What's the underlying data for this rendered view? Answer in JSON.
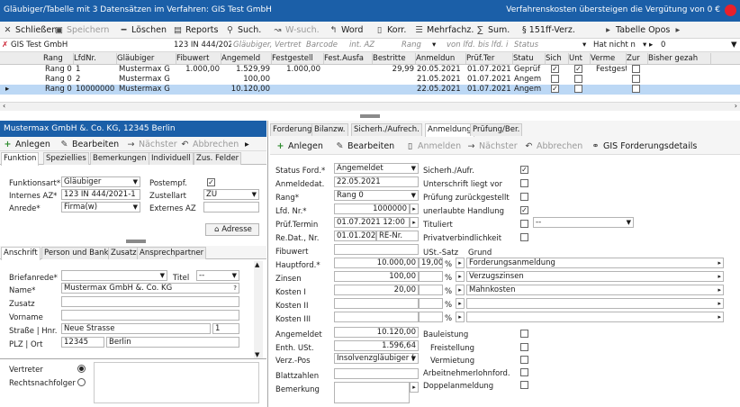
{
  "titlebar": {
    "left": "Gläubiger/Tabelle mit 3 Datensätzen im Verfahren: GIS Test GmbH",
    "right": "Verfahrenskosten übersteigen die Vergütung von 0 €"
  },
  "toolbar": {
    "close": "Schließen",
    "save": "Speichern",
    "delete": "Löschen",
    "reports": "Reports",
    "search": "Such.",
    "wsearch": "W-such.",
    "word": "Word",
    "korr": "Korr.",
    "mehrfachz": "Mehrfachz.",
    "sum": "Sum.",
    "verz": "§ 151ff-Verz.",
    "tabelle": "Tabelle Opos"
  },
  "filter": {
    "name": "GIS Test GmbH",
    "az": "123 IN 444/202",
    "glaeubiger": "Gläubiger, Vertret",
    "barcode": "Barcode",
    "intaz": "int. AZ",
    "rang": "Rang",
    "vonlfd": "von lfd.",
    "bislfd": "bis lfd. i",
    "status": "Status",
    "hatnicht": "Hat nicht n",
    "zero": "0"
  },
  "grid": {
    "headers": [
      "Rang",
      "LfdNr.",
      "Gläubiger",
      "Fibuwert",
      "Angemeld",
      "Festgestell",
      "Fest.Ausfa",
      "Bestritte",
      "Anmeldun",
      "Prüf.Ter",
      "Statu",
      "Sich",
      "Unt",
      "Verme",
      "Zur",
      "Bisher gezah"
    ],
    "rows": [
      {
        "rang": "Rang 0",
        "lfd": "1",
        "gl": "Mustermax G",
        "fibu": "1.000,00",
        "angem": "1.529,99",
        "festg": "1.000,00",
        "festa": "",
        "bestr": "29,99",
        "anm": "20.05.2021",
        "pruef": "01.07.2021",
        "status": "Geprüf",
        "sich": "✓",
        "unt": "✓",
        "verme": "Festgest",
        "zur": "",
        "bisher": ""
      },
      {
        "rang": "Rang 0",
        "lfd": "2",
        "gl": "Mustermax G",
        "fibu": "",
        "angem": "100,00",
        "festg": "",
        "festa": "",
        "bestr": "",
        "anm": "21.05.2021",
        "pruef": "01.07.2021",
        "status": "Angem",
        "sich": "",
        "unt": "",
        "verme": "",
        "zur": "",
        "bisher": ""
      },
      {
        "rang": "Rang 0",
        "lfd": "10000000",
        "gl": "Mustermax G",
        "fibu": "",
        "angem": "10.120,00",
        "festg": "",
        "festa": "",
        "bestr": "",
        "anm": "22.05.2021",
        "pruef": "01.07.2021",
        "status": "Angem",
        "sich": "✓",
        "unt": "",
        "verme": "",
        "zur": "",
        "bisher": ""
      }
    ]
  },
  "left": {
    "title": "Mustermax GmbH &. Co. KG, 12345 Berlin",
    "actions": {
      "new": "Anlegen",
      "edit": "Bearbeiten",
      "next": "Nächster",
      "cancel": "Abbrechen"
    },
    "tabs1": [
      "Funktion",
      "Speziellies",
      "Bemerkungen",
      "Individuell",
      "Zus. Felder"
    ],
    "funktion": {
      "funktionsart_l": "Funktionsart*",
      "funktionsart_v": "Gläubiger",
      "postempf_l": "Postempf.",
      "internes_l": "Internes AZ*",
      "internes_v": "123 IN 444/2021-1",
      "zustellart_l": "Zustellart",
      "zustellart_v": "ZU",
      "anrede_l": "Anrede*",
      "anrede_v": "Firma(w)",
      "externes_l": "Externes AZ",
      "adresse": "Adresse"
    },
    "tabs2": [
      "Anschrift",
      "Person und Bank",
      "Zusatz",
      "Ansprechpartner"
    ],
    "anschrift": {
      "briefanrede_l": "Briefanrede*",
      "titel_l": "Titel",
      "titel_v": "--",
      "name_l": "Name*",
      "name_v": "Mustermax GmbH &. Co. KG",
      "q": "?",
      "zusatz_l": "Zusatz",
      "vorname_l": "Vorname",
      "strasse_l": "Straße | Hnr.",
      "strasse_v": "Neue Strasse",
      "hnr_v": "1",
      "plz_l": "PLZ | Ort",
      "plz_v": "12345",
      "ort_v": "Berlin"
    },
    "vertreter": "Vertreter",
    "rechtsnachfolger": "Rechtsnachfolger"
  },
  "right": {
    "tabs": [
      "Forderung",
      "Bilanzw.",
      "Sicherh./Aufrech.",
      "Anmeldung",
      "Prüfung/Ber."
    ],
    "actions": {
      "new": "Anlegen",
      "edit": "Bearbeiten",
      "anmelden": "Anmelden",
      "next": "Nächster",
      "cancel": "Abbrechen",
      "gis": "GIS Forderungsdetails"
    },
    "form": {
      "status_l": "Status Ford.*",
      "status_v": "Angemeldet",
      "anmeldedat_l": "Anmeldedat.",
      "anmeldedat_v": "22.05.2021",
      "rang_l": "Rang*",
      "rang_v": "Rang 0",
      "lfd_l": "Lfd. Nr.*",
      "lfd_v": "1000000",
      "prueft_l": "Prüf.Termin",
      "prueft_v": "01.07.2021 12:00",
      "redat_l": "Re.Dat., Nr.",
      "redat_v": "01.01.202",
      "renr_v": "RE-Nr.",
      "fibu_l": "Fibuwert",
      "haupt_l": "Hauptford.*",
      "haupt_v": "10.000,00",
      "zinsen_l": "Zinsen",
      "zinsen_v": "100,00",
      "k1_l": "Kosten I",
      "k1_v": "20,00",
      "k2_l": "Kosten II",
      "k3_l": "Kosten III",
      "angem_l": "Angemeldet",
      "angem_v": "10.120,00",
      "ust_l": "Enth. USt.",
      "ust_v": "1.596,64",
      "verz_l": "Verz.-Pos",
      "verz_v": "Insolvenzgläubiger (",
      "blatt_l": "Blattzahlen",
      "bem_l": "Bemerkung"
    },
    "mid": {
      "sich": "Sicherh./Aufr.",
      "unters": "Unterschrift liegt vor",
      "pruef": "Prüfung zurückgestellt",
      "unerl": "unerlaubte Handlung",
      "titel": "Tituliert",
      "titel_sel": "--",
      "priv": "Privatverbindlichkeit",
      "ust": "USt.-Satz",
      "grund": "Grund",
      "ust_v": "19,00",
      "pct": "%",
      "g1": "Forderungsanmeldung",
      "g2": "Verzugszinsen",
      "g3": "Mahnkosten",
      "bau": "Bauleistung",
      "frei": "Freistellung",
      "verm": "Vermietung",
      "arb": "Arbeitnehmerlohnford.",
      "dopp": "Doppelanmeldung"
    }
  },
  "colors": {
    "accent": "#1b5fa8",
    "alert": "#e8202a",
    "selected": "#bcd8f5"
  }
}
